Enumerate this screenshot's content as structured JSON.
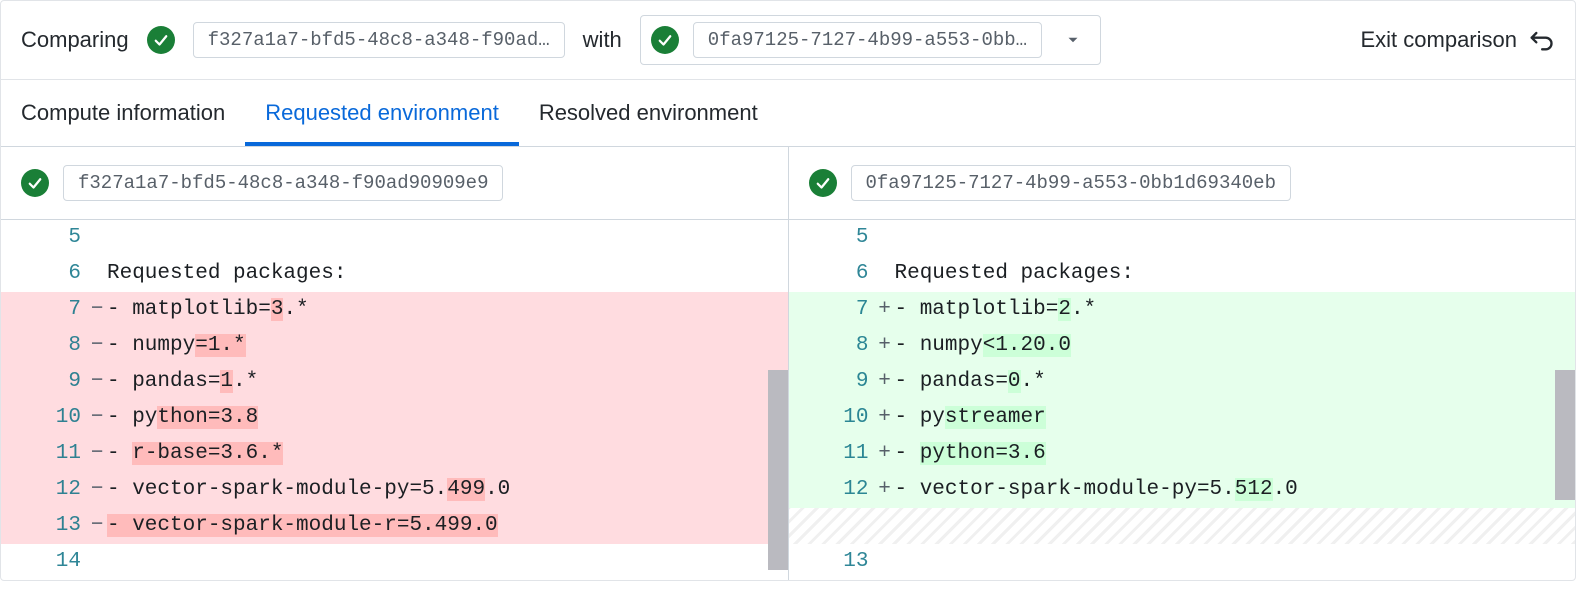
{
  "header": {
    "comparing_label": "Comparing",
    "with_label": "with",
    "left_hash_short": "f327a1a7-bfd5-48c8-a348-f90ad…",
    "right_hash_short": "0fa97125-7127-4b99-a553-0bb…",
    "exit_label": "Exit comparison"
  },
  "tabs": [
    {
      "label": "Compute information",
      "active": false
    },
    {
      "label": "Requested environment",
      "active": true
    },
    {
      "label": "Resolved environment",
      "active": false
    }
  ],
  "left": {
    "hash": "f327a1a7-bfd5-48c8-a348-f90ad90909e9",
    "lines": [
      {
        "n": "5",
        "type": "ctx",
        "text": ""
      },
      {
        "n": "6",
        "type": "ctx",
        "text": "Requested packages:"
      },
      {
        "n": "7",
        "type": "del",
        "text_pre": "- matplotlib=",
        "hl": "3",
        "text_post": ".*"
      },
      {
        "n": "8",
        "type": "del",
        "text_pre": "- numpy",
        "hl": "=1.*",
        "text_post": ""
      },
      {
        "n": "9",
        "type": "del",
        "text_pre": "- pandas=",
        "hl": "1",
        "text_post": ".*"
      },
      {
        "n": "10",
        "type": "del",
        "text_pre": "- py",
        "hl": "thon=3.8",
        "text_post": ""
      },
      {
        "n": "11",
        "type": "del",
        "text_pre": "- ",
        "hl": "r-base=3.6.*",
        "text_post": ""
      },
      {
        "n": "12",
        "type": "del",
        "text_pre": "- vector-spark-module-py=5.",
        "hl": "499",
        "text_post": ".0"
      },
      {
        "n": "13",
        "type": "del",
        "text_pre": "",
        "hl": "- vector-spark-module-r=5.499.0",
        "text_post": ""
      },
      {
        "n": "14",
        "type": "ctx",
        "text": ""
      }
    ]
  },
  "right": {
    "hash": "0fa97125-7127-4b99-a553-0bb1d69340eb",
    "lines": [
      {
        "n": "5",
        "type": "ctx",
        "text": ""
      },
      {
        "n": "6",
        "type": "ctx",
        "text": "Requested packages:"
      },
      {
        "n": "7",
        "type": "add",
        "text_pre": "- matplotlib=",
        "hl": "2",
        "text_post": ".*"
      },
      {
        "n": "8",
        "type": "add",
        "text_pre": "- numpy",
        "hl": "<1.20.0",
        "text_post": ""
      },
      {
        "n": "9",
        "type": "add",
        "text_pre": "- pandas=",
        "hl": "0",
        "text_post": ".*"
      },
      {
        "n": "10",
        "type": "add",
        "text_pre": "- py",
        "hl": "streamer",
        "text_post": ""
      },
      {
        "n": "11",
        "type": "add",
        "text_pre": "- ",
        "hl": "python=3.6",
        "text_post": ""
      },
      {
        "n": "12",
        "type": "add",
        "text_pre": "- vector-spark-module-py=5.",
        "hl": "512",
        "text_post": ".0"
      },
      {
        "n": "",
        "type": "placeholder"
      },
      {
        "n": "13",
        "type": "ctx",
        "text": ""
      }
    ]
  }
}
